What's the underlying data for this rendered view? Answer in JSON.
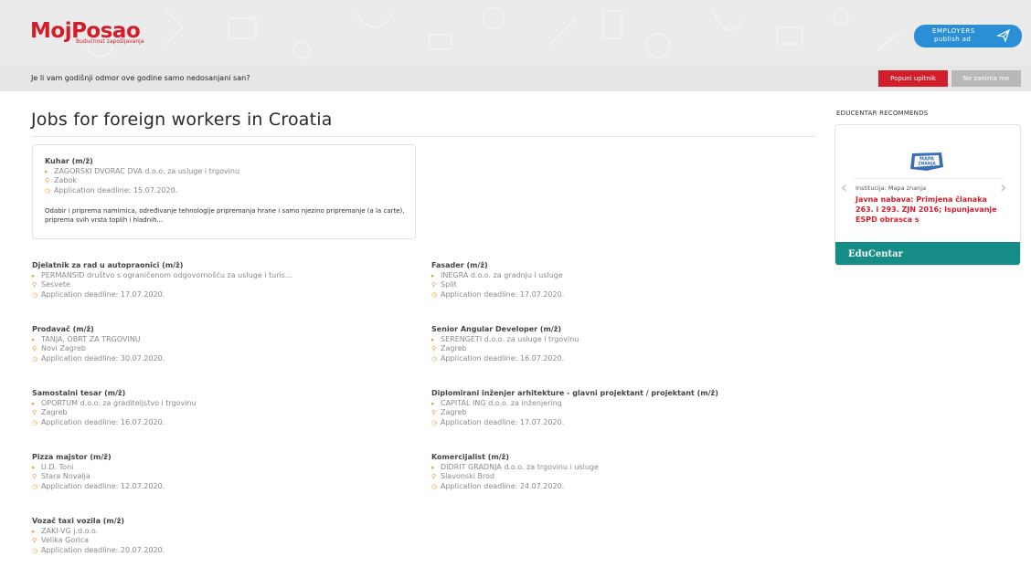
{
  "header": {
    "logo_text": "MojPosao",
    "logo_tagline": "Budućnost zapošljavanja",
    "employers_line1": "EMPLOYERS",
    "employers_line2": "publish ad",
    "send_icon": "send-icon"
  },
  "survey": {
    "question": "Je li vam godišnji odmor ove godine samo nedosanjani san?",
    "fill_label": "Popuni upitnik",
    "dismiss_label": "Ne zanima me"
  },
  "page_title": "Jobs for foreign workers in Croatia",
  "featured_job": {
    "title": "Kuhar (m/ž)",
    "company": "ZAGORSKI DVORAC DVA d.o.o. za usluge i trgovinu",
    "location": "Zabok",
    "deadline": "Application deadline: 15.07.2020.",
    "description": "Odabir i priprema namirnica, određivanje tehnologije pripremanja hrane i samo njezino pripremanje (a la carte), priprema svih vrsta toplih i hladnih..."
  },
  "jobs": [
    {
      "title": "Djelatnik za rad u autopraonici (m/ž)",
      "company": "PERMANSID društvo s ograničenom odgovornošću za usluge i turis...",
      "location": "Sesvete",
      "deadline": "Application deadline: 17.07.2020."
    },
    {
      "title": "Fasader (m/ž)",
      "company": "INEGRA d.o.o. za gradnju i usluge",
      "location": "Split",
      "deadline": "Application deadline: 17.07.2020."
    },
    {
      "title": "Prodavač (m/ž)",
      "company": "TANJA, OBRT ZA TRGOVINU",
      "location": "Novi Zagreb",
      "deadline": "Application deadline: 30.07.2020."
    },
    {
      "title": "Senior Angular Developer (m/ž)",
      "company": "SERENGETI d.o.o. za usluge i trgovinu",
      "location": "Zagreb",
      "deadline": "Application deadline: 16.07.2020."
    },
    {
      "title": "Samostalni tesar (m/ž)",
      "company": "OPORTUM d.o.o. za graditeljstvo i trgovinu",
      "location": "Zagreb",
      "deadline": "Application deadline: 16.07.2020."
    },
    {
      "title": "Diplomirani inženjer arhitekture - glavni projektant / projektant (m/ž)",
      "company": "CAPITAL ING d.o.o. za inženjering",
      "location": "Zagreb",
      "deadline": "Application deadline: 17.07.2020."
    },
    {
      "title": "Pizza majstor (m/ž)",
      "company": "U.D. Toni",
      "location": "Stara Novalja",
      "deadline": "Application deadline: 12.07.2020."
    },
    {
      "title": "Komercijalist (m/ž)",
      "company": "DIDRIT GRADNJA d.o.o. za trgovinu i usluge",
      "location": "Slavonski Brod",
      "deadline": "Application deadline: 24.07.2020."
    },
    {
      "title": "Vozač taxi vozila (m/ž)",
      "company": "ZAKI-VG j.d.o.o.",
      "location": "Velika Gorica",
      "deadline": "Application deadline: 20.07.2020."
    }
  ],
  "sidebar": {
    "heading": "EDUCENTAR RECOMMENDS",
    "logo_line1": "MAPA",
    "logo_line2": "ZNANJA",
    "institution": "Institucija: Mapa znanja",
    "link": "Javna nabava: Primjena članaka 263. i 293. ZJN 2016; Ispunjavanje ESPD obrasca s",
    "footer": "EduCentar",
    "brand_color": "#168c86"
  }
}
